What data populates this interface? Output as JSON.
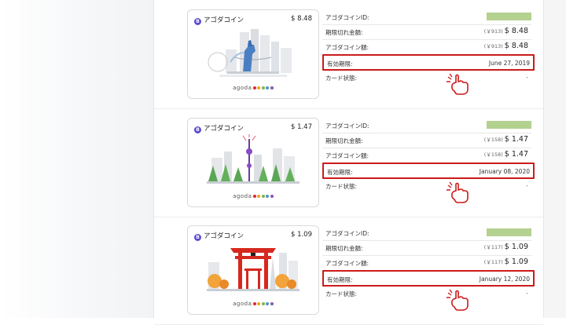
{
  "cards": [
    {
      "coin_label": "アゴダコイン",
      "amount": "$ 8.48",
      "brand": "agoda",
      "illustration": "singapore-merlion-skyline",
      "rows": {
        "id_label": "アゴダコインID:",
        "expiring_label": "期限切れ金額:",
        "expiring_yen": "(￥913)",
        "expiring_amount": "$ 8.48",
        "balance_label": "アゴダコイン額:",
        "balance_yen": "(￥913)",
        "balance_amount": "$ 8.48",
        "validity_label": "有効期限:",
        "validity_date": "June 27, 2019",
        "status_label": "カード状態:",
        "status_value": "-"
      }
    },
    {
      "coin_label": "アゴダコイン",
      "amount": "$ 1.47",
      "brand": "agoda",
      "illustration": "shanghai-tower-skyline",
      "rows": {
        "id_label": "アゴダコインID:",
        "expiring_label": "期限切れ金額:",
        "expiring_yen": "(￥158)",
        "expiring_amount": "$ 1.47",
        "balance_label": "アゴダコイン額:",
        "balance_yen": "(￥158)",
        "balance_amount": "$ 1.47",
        "validity_label": "有効期限:",
        "validity_date": "January 08, 2020",
        "status_label": "カード状態:",
        "status_value": "-"
      }
    },
    {
      "coin_label": "アゴダコイン",
      "amount": "$ 1.09",
      "brand": "agoda",
      "illustration": "japan-torii-gate",
      "rows": {
        "id_label": "アゴダコインID:",
        "expiring_label": "期限切れ金額:",
        "expiring_yen": "(￥117)",
        "expiring_amount": "$ 1.09",
        "balance_label": "アゴダコイン額:",
        "balance_yen": "(￥117)",
        "balance_amount": "$ 1.09",
        "validity_label": "有効期限:",
        "validity_date": "January 12, 2020",
        "status_label": "カード状態:",
        "status_value": "-"
      }
    }
  ],
  "colors": {
    "highlight": "#cc1a1a",
    "id_bar": "#b3d18f",
    "coin_icon": "#5b4bd1",
    "agoda_dots": [
      "#e4262a",
      "#f7a11a",
      "#7ab648",
      "#5392d0",
      "#8159b4"
    ]
  },
  "icons": [
    "coin-icon",
    "pointing-hand-icon"
  ]
}
